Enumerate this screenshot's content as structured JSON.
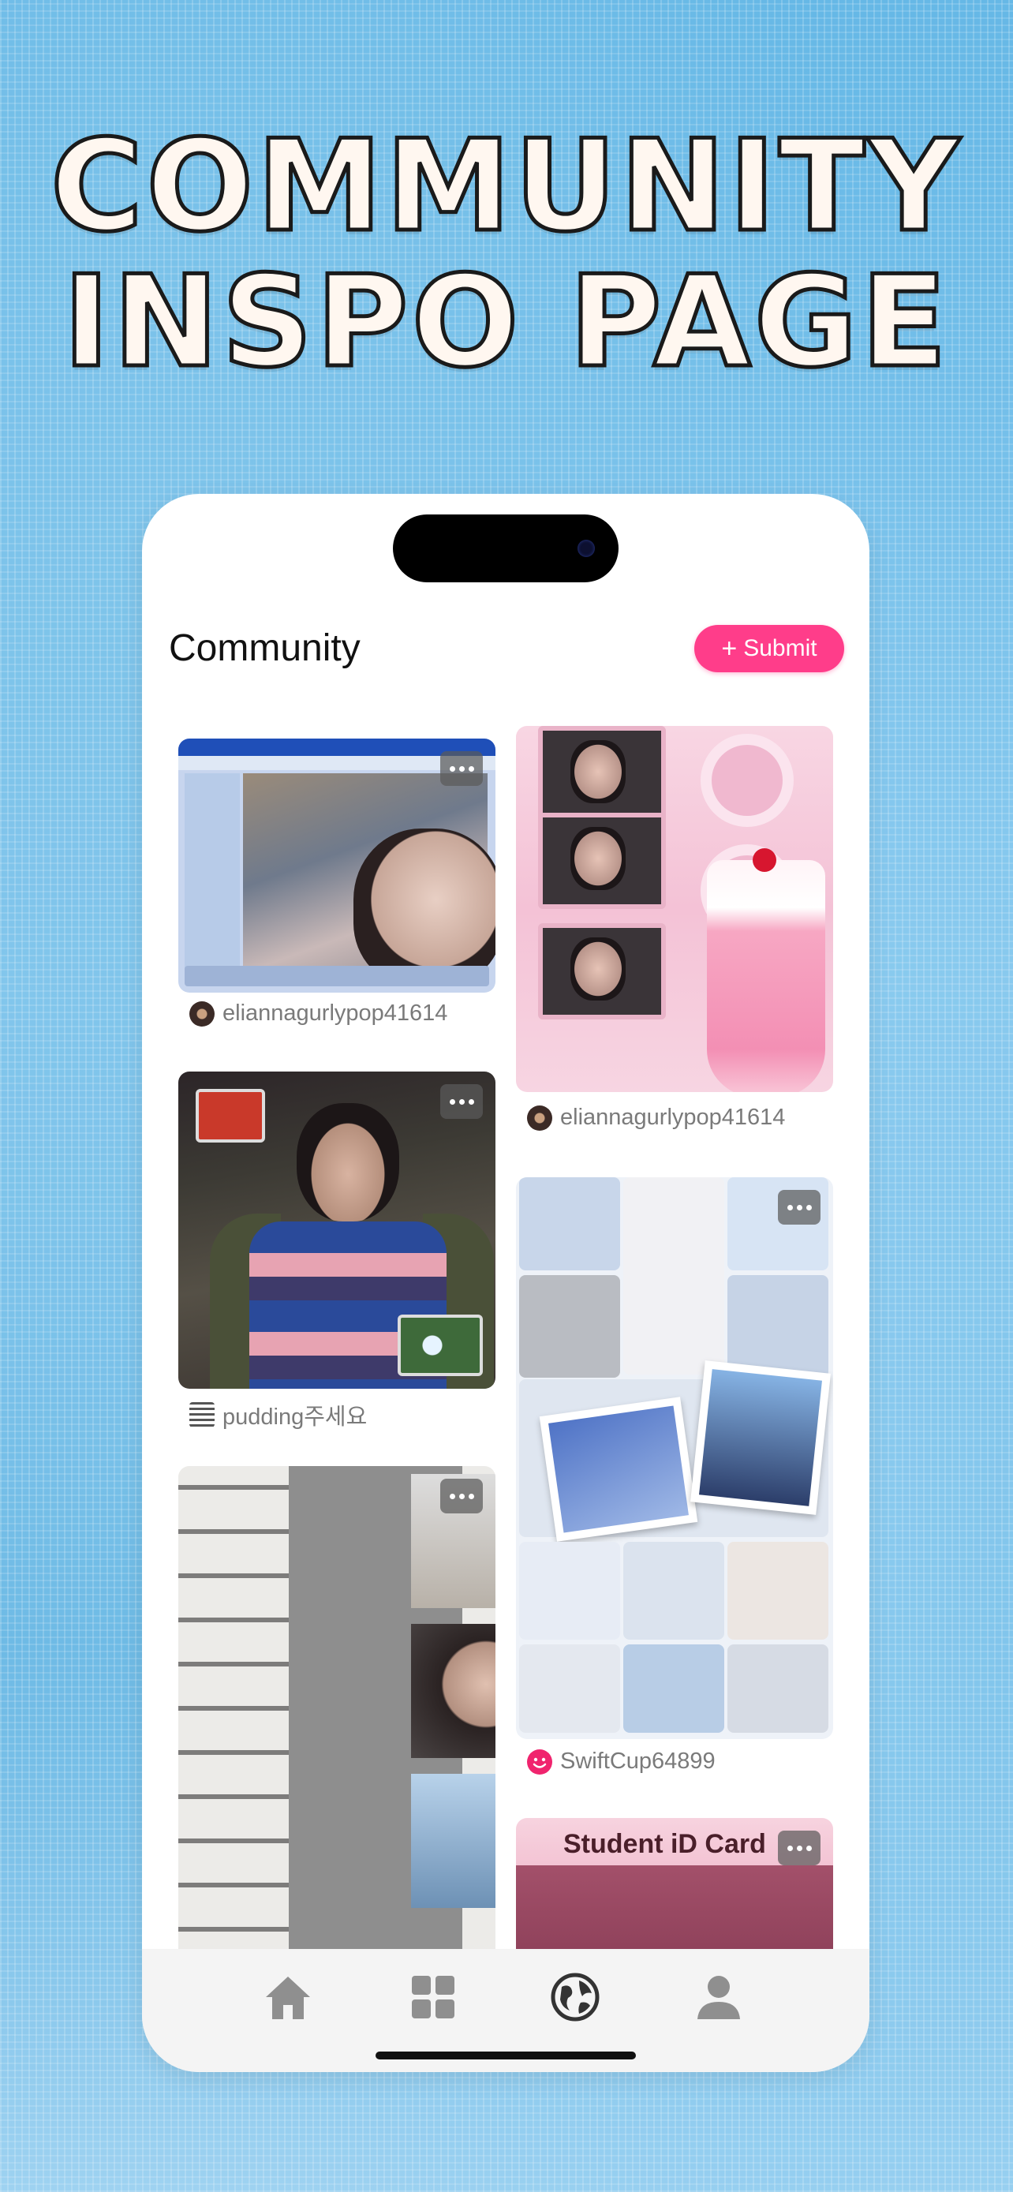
{
  "headline": {
    "line1": "COMMUNITY",
    "line2": "INSPO PAGE"
  },
  "header": {
    "title": "Community",
    "submit_label": "Submit",
    "submit_icon": "plus-icon"
  },
  "colors": {
    "accent": "#ff3d8a",
    "background": "#6ab8e4",
    "username": "#7a7a7a"
  },
  "posts": [
    {
      "author": "eliannagurlypop41614",
      "image": "windows-media-player-mirror-selfie"
    },
    {
      "author": "eliannagurlypop41614",
      "image": "pink-ipod-milkshake-collage"
    },
    {
      "author": "pudding주세요",
      "image": "boy-in-green-jacket"
    },
    {
      "author": "SwiftCup64899",
      "image": "light-blue-aesthetic-collage"
    },
    {
      "author": "",
      "image": "japanese-text-photo-strip"
    },
    {
      "author": "",
      "image": "student-id-card",
      "overlay_text": "Student iD Card"
    }
  ],
  "tabbar": {
    "items": [
      {
        "name": "home-icon",
        "active": false
      },
      {
        "name": "grid-icon",
        "active": false
      },
      {
        "name": "globe-icon",
        "active": true
      },
      {
        "name": "profile-icon",
        "active": false
      }
    ]
  }
}
